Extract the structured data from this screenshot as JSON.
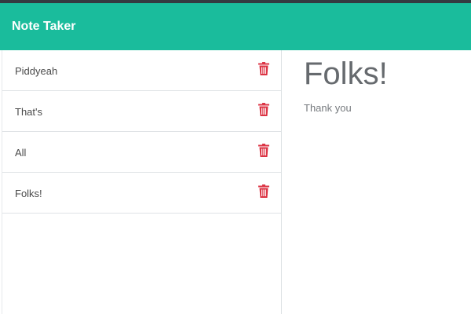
{
  "navbar": {
    "brand": "Note Taker"
  },
  "colors": {
    "accent": "#1abc9c",
    "delete": "#dc3545"
  },
  "notes": [
    {
      "title": "Piddyeah",
      "icon": "trash-icon"
    },
    {
      "title": "That's",
      "icon": "trash-icon"
    },
    {
      "title": "All",
      "icon": "trash-icon"
    },
    {
      "title": "Folks!",
      "icon": "trash-icon"
    }
  ],
  "active_note": {
    "title": "Folks!",
    "text": "Thank you"
  }
}
